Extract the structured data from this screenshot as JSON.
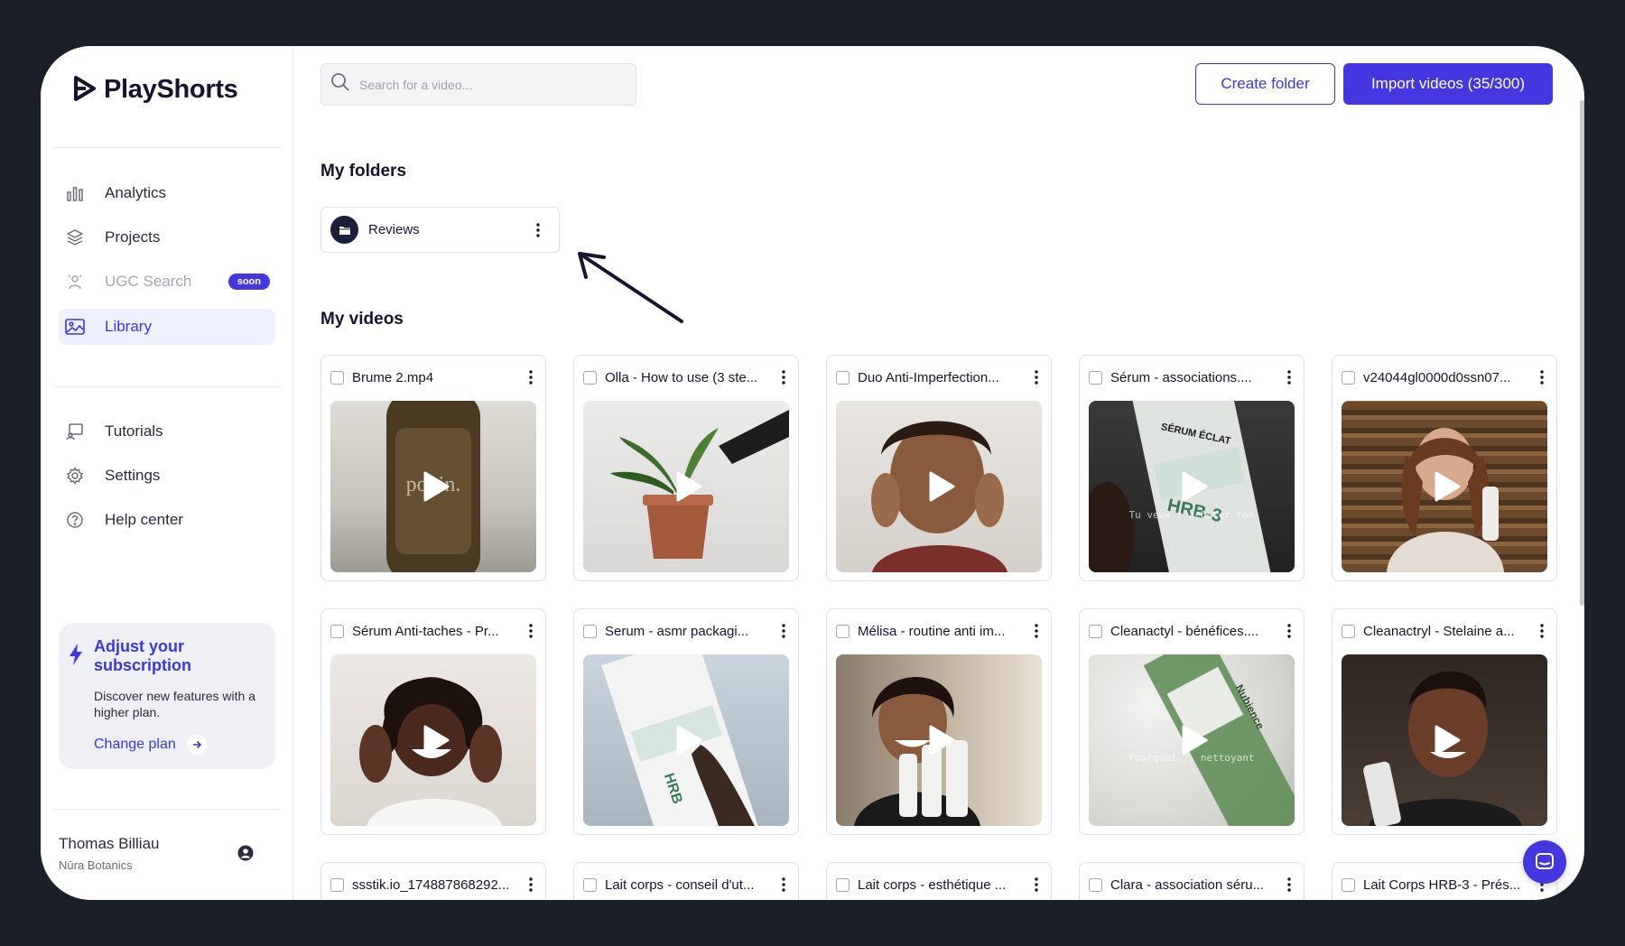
{
  "app": {
    "brand": "PlayShorts"
  },
  "sidebar": {
    "nav_primary": [
      {
        "label": "Analytics",
        "icon": "bar-chart-icon"
      },
      {
        "label": "Projects",
        "icon": "layers-icon"
      },
      {
        "label": "UGC Search",
        "icon": "person-search-icon",
        "badge": "soon"
      },
      {
        "label": "Library",
        "icon": "image-icon",
        "active": true
      }
    ],
    "nav_secondary": [
      {
        "label": "Tutorials",
        "icon": "presentation-icon"
      },
      {
        "label": "Settings",
        "icon": "gear-icon"
      },
      {
        "label": "Help center",
        "icon": "help-circle-icon"
      }
    ],
    "promo": {
      "title": "Adjust your subscription",
      "text": "Discover new features with a higher plan.",
      "link": "Change plan"
    },
    "user": {
      "name": "Thomas Billiau",
      "org": "Nūra Botanics"
    }
  },
  "toolbar": {
    "search_placeholder": "Search for a video...",
    "create_folder": "Create folder",
    "import_videos": "Import videos (35/300)"
  },
  "folders_section": {
    "title": "My folders",
    "folders": [
      {
        "name": "Reviews"
      }
    ]
  },
  "videos_section": {
    "title": "My videos",
    "videos": [
      {
        "title": "Brume 2.mp4"
      },
      {
        "title": "Olla - How to use (3 ste..."
      },
      {
        "title": "Duo Anti-Imperfection..."
      },
      {
        "title": "Sérum - associations...."
      },
      {
        "title": "v24044gl0000d0ssn07..."
      },
      {
        "title": "Sérum Anti-taches - Pr..."
      },
      {
        "title": "Serum - asmr packagi..."
      },
      {
        "title": "Mélisa - routine anti im..."
      },
      {
        "title": "Cleanactyl - bénéfices...."
      },
      {
        "title": "Cleanactryl - Stelaine a..."
      },
      {
        "title": "ssstik.io_174887868292..."
      },
      {
        "title": "Lait corps - conseil d'ut..."
      },
      {
        "title": "Lait corps - esthétique ..."
      },
      {
        "title": "Clara - association séru..."
      },
      {
        "title": "Lait Corps HRB-3 - Prés..."
      }
    ],
    "thumb_captions": {
      "serum_associations": "Tu veux t'acheter ton",
      "cleanactyl": "Pourquoi... nettoyant"
    }
  },
  "colors": {
    "accent": "#4437e0",
    "background_frame": "#1b1f27",
    "active_nav_bg": "#eef0ff"
  }
}
